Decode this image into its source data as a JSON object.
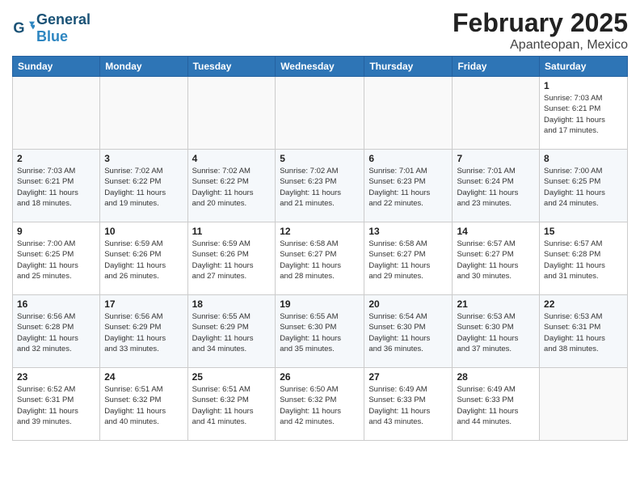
{
  "header": {
    "logo_general": "General",
    "logo_blue": "Blue",
    "month_title": "February 2025",
    "subtitle": "Apanteopan, Mexico"
  },
  "calendar": {
    "weekdays": [
      "Sunday",
      "Monday",
      "Tuesday",
      "Wednesday",
      "Thursday",
      "Friday",
      "Saturday"
    ],
    "weeks": [
      [
        {
          "day": "",
          "info": ""
        },
        {
          "day": "",
          "info": ""
        },
        {
          "day": "",
          "info": ""
        },
        {
          "day": "",
          "info": ""
        },
        {
          "day": "",
          "info": ""
        },
        {
          "day": "",
          "info": ""
        },
        {
          "day": "1",
          "info": "Sunrise: 7:03 AM\nSunset: 6:21 PM\nDaylight: 11 hours\nand 17 minutes."
        }
      ],
      [
        {
          "day": "2",
          "info": "Sunrise: 7:03 AM\nSunset: 6:21 PM\nDaylight: 11 hours\nand 18 minutes."
        },
        {
          "day": "3",
          "info": "Sunrise: 7:02 AM\nSunset: 6:22 PM\nDaylight: 11 hours\nand 19 minutes."
        },
        {
          "day": "4",
          "info": "Sunrise: 7:02 AM\nSunset: 6:22 PM\nDaylight: 11 hours\nand 20 minutes."
        },
        {
          "day": "5",
          "info": "Sunrise: 7:02 AM\nSunset: 6:23 PM\nDaylight: 11 hours\nand 21 minutes."
        },
        {
          "day": "6",
          "info": "Sunrise: 7:01 AM\nSunset: 6:23 PM\nDaylight: 11 hours\nand 22 minutes."
        },
        {
          "day": "7",
          "info": "Sunrise: 7:01 AM\nSunset: 6:24 PM\nDaylight: 11 hours\nand 23 minutes."
        },
        {
          "day": "8",
          "info": "Sunrise: 7:00 AM\nSunset: 6:25 PM\nDaylight: 11 hours\nand 24 minutes."
        }
      ],
      [
        {
          "day": "9",
          "info": "Sunrise: 7:00 AM\nSunset: 6:25 PM\nDaylight: 11 hours\nand 25 minutes."
        },
        {
          "day": "10",
          "info": "Sunrise: 6:59 AM\nSunset: 6:26 PM\nDaylight: 11 hours\nand 26 minutes."
        },
        {
          "day": "11",
          "info": "Sunrise: 6:59 AM\nSunset: 6:26 PM\nDaylight: 11 hours\nand 27 minutes."
        },
        {
          "day": "12",
          "info": "Sunrise: 6:58 AM\nSunset: 6:27 PM\nDaylight: 11 hours\nand 28 minutes."
        },
        {
          "day": "13",
          "info": "Sunrise: 6:58 AM\nSunset: 6:27 PM\nDaylight: 11 hours\nand 29 minutes."
        },
        {
          "day": "14",
          "info": "Sunrise: 6:57 AM\nSunset: 6:27 PM\nDaylight: 11 hours\nand 30 minutes."
        },
        {
          "day": "15",
          "info": "Sunrise: 6:57 AM\nSunset: 6:28 PM\nDaylight: 11 hours\nand 31 minutes."
        }
      ],
      [
        {
          "day": "16",
          "info": "Sunrise: 6:56 AM\nSunset: 6:28 PM\nDaylight: 11 hours\nand 32 minutes."
        },
        {
          "day": "17",
          "info": "Sunrise: 6:56 AM\nSunset: 6:29 PM\nDaylight: 11 hours\nand 33 minutes."
        },
        {
          "day": "18",
          "info": "Sunrise: 6:55 AM\nSunset: 6:29 PM\nDaylight: 11 hours\nand 34 minutes."
        },
        {
          "day": "19",
          "info": "Sunrise: 6:55 AM\nSunset: 6:30 PM\nDaylight: 11 hours\nand 35 minutes."
        },
        {
          "day": "20",
          "info": "Sunrise: 6:54 AM\nSunset: 6:30 PM\nDaylight: 11 hours\nand 36 minutes."
        },
        {
          "day": "21",
          "info": "Sunrise: 6:53 AM\nSunset: 6:30 PM\nDaylight: 11 hours\nand 37 minutes."
        },
        {
          "day": "22",
          "info": "Sunrise: 6:53 AM\nSunset: 6:31 PM\nDaylight: 11 hours\nand 38 minutes."
        }
      ],
      [
        {
          "day": "23",
          "info": "Sunrise: 6:52 AM\nSunset: 6:31 PM\nDaylight: 11 hours\nand 39 minutes."
        },
        {
          "day": "24",
          "info": "Sunrise: 6:51 AM\nSunset: 6:32 PM\nDaylight: 11 hours\nand 40 minutes."
        },
        {
          "day": "25",
          "info": "Sunrise: 6:51 AM\nSunset: 6:32 PM\nDaylight: 11 hours\nand 41 minutes."
        },
        {
          "day": "26",
          "info": "Sunrise: 6:50 AM\nSunset: 6:32 PM\nDaylight: 11 hours\nand 42 minutes."
        },
        {
          "day": "27",
          "info": "Sunrise: 6:49 AM\nSunset: 6:33 PM\nDaylight: 11 hours\nand 43 minutes."
        },
        {
          "day": "28",
          "info": "Sunrise: 6:49 AM\nSunset: 6:33 PM\nDaylight: 11 hours\nand 44 minutes."
        },
        {
          "day": "",
          "info": ""
        }
      ]
    ]
  }
}
